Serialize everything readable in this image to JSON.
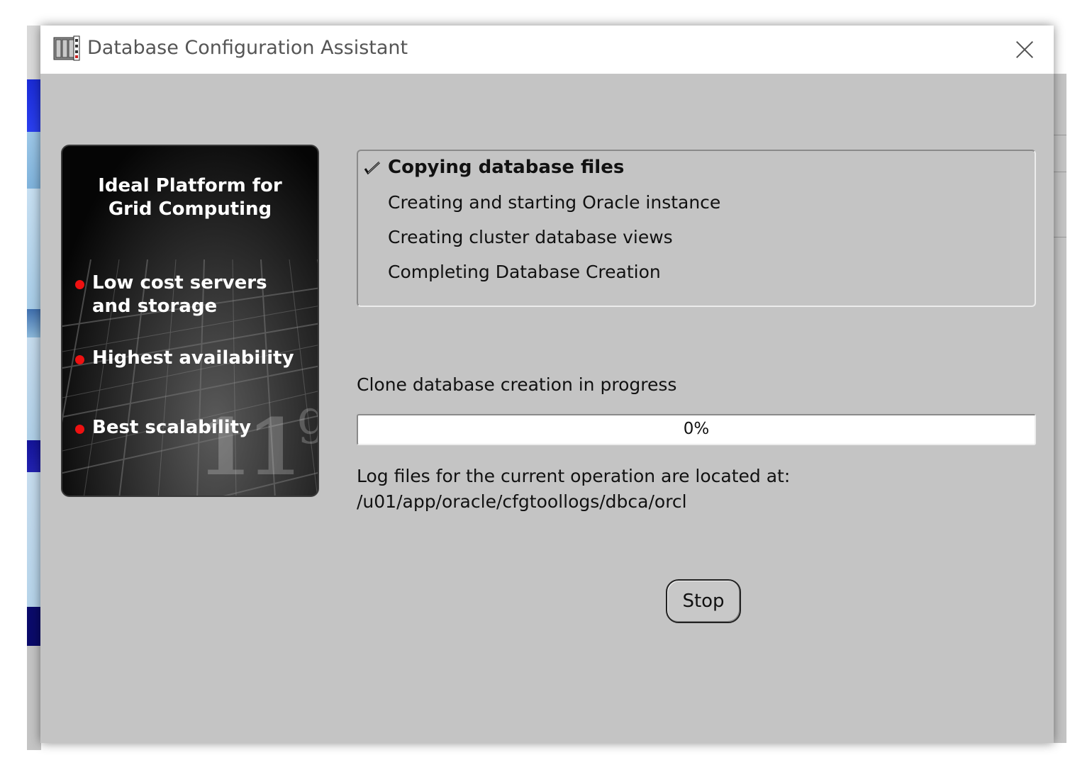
{
  "window": {
    "title": "Database Configuration Assistant"
  },
  "promo": {
    "heading_line1": "Ideal Platform for",
    "heading_line2": "Grid Computing",
    "items": [
      {
        "line1": "Low cost servers",
        "line2": "and storage"
      },
      {
        "line1": "Highest availability",
        "line2": ""
      },
      {
        "line1": "Best scalability",
        "line2": ""
      }
    ],
    "bullet_color": "#ee1111",
    "logo_text": "11",
    "logo_sup": "g"
  },
  "steps": [
    {
      "label": "Copying database files",
      "status": "in-progress"
    },
    {
      "label": "Creating and starting Oracle instance",
      "status": "pending"
    },
    {
      "label": "Creating cluster database views",
      "status": "pending"
    },
    {
      "label": "Completing Database Creation",
      "status": "pending"
    }
  ],
  "status_text": "Clone database creation in progress",
  "progress": {
    "value": 0,
    "label": "0%"
  },
  "log": {
    "line1": "Log files for the current operation are located at:",
    "line2": "/u01/app/oracle/cfgtoollogs/dbca/orcl"
  },
  "buttons": {
    "stop_label": "Stop"
  },
  "icons": {
    "app": "database-app-icon",
    "close": "close-icon",
    "step_current": "checkmark-icon"
  }
}
